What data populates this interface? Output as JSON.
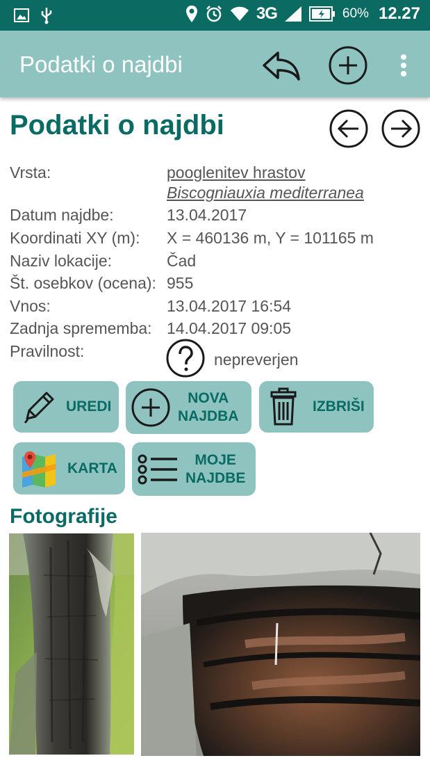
{
  "status_bar": {
    "network": "3G",
    "battery_percent": "60%",
    "time": "12.27"
  },
  "app_bar": {
    "title": "Podatki o najdbi"
  },
  "page": {
    "title": "Podatki o najdbi"
  },
  "fields": {
    "species_label": "Vrsta:",
    "species_common": "pooglenitev hrastov",
    "species_latin": "Biscogniauxia mediterranea",
    "date_label": "Datum najdbe:",
    "date_value": "13.04.2017",
    "coords_label": "Koordinati XY (m):",
    "coords_value": "X = 460136 m, Y = 101165 m",
    "location_label": "Naziv lokacije:",
    "location_value": "Čad",
    "count_label": "Št. osebkov (ocena):",
    "count_value": "955",
    "entry_label": "Vnos:",
    "entry_value": "13.04.2017 16:54",
    "modified_label": "Zadnja sprememba:",
    "modified_value": "14.04.2017 09:05",
    "validity_label": "Pravilnost:",
    "validity_value": "nepreverjen"
  },
  "buttons": {
    "edit": "UREDI",
    "new_line1": "NOVA",
    "new_line2": "NAJDBA",
    "delete": "IZBRIŠI",
    "map": "KARTA",
    "mine_line1": "MOJE",
    "mine_line2": "NAJDBE"
  },
  "photos": {
    "title": "Fotografije"
  },
  "colors": {
    "status_bar": "#0b6b62",
    "app_bar": "#8fc3c0",
    "accent_text": "#0a6a64",
    "body_text": "#555555"
  },
  "icons": [
    "image-icon",
    "usb-icon",
    "location-icon",
    "alarm-icon",
    "wifi-icon",
    "signal-icon",
    "battery-icon",
    "reply-icon",
    "add-circle-icon",
    "more-vert-icon",
    "arrow-left-icon",
    "arrow-right-icon",
    "question-icon",
    "pencil-icon",
    "trash-icon",
    "map-icon",
    "list-icon"
  ]
}
